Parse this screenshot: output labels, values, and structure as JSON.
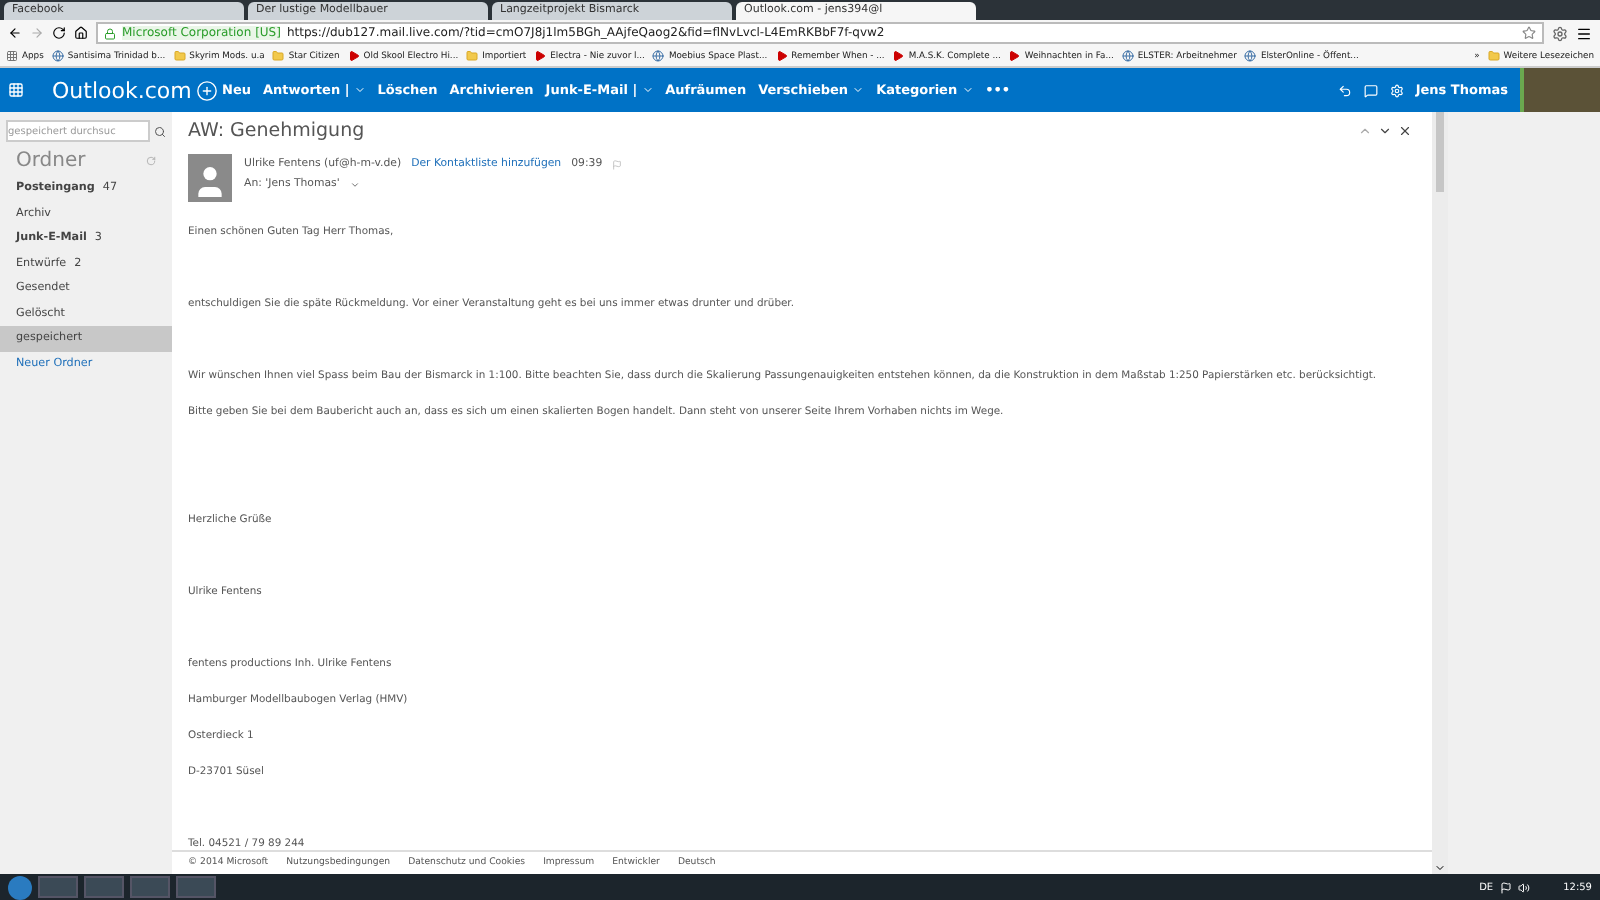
{
  "browser": {
    "tabs": [
      {
        "title": "Facebook",
        "selected": false
      },
      {
        "title": "Der lustige Modellbauer",
        "selected": false
      },
      {
        "title": "Langzeitprojekt Bismarck",
        "selected": false
      },
      {
        "title": "Outlook.com - jens394@l",
        "selected": true
      }
    ],
    "address": {
      "secure_label": "Microsoft Corporation [US]",
      "url": "https://dub127.mail.live.com/?tid=cmO7J8j1lm5BGh_AAjfeQaog2&fid=flNvLvcl-L4EmRKBbF7f-qvw2"
    },
    "bookmarks": [
      {
        "label": "Apps",
        "kind": "apps"
      },
      {
        "label": "Santisima Trinidad b...",
        "kind": "site"
      },
      {
        "label": "Skyrim Mods. u.a",
        "kind": "folder"
      },
      {
        "label": "Star Citizen",
        "kind": "folder"
      },
      {
        "label": "Old Skool Electro Hi...",
        "kind": "video"
      },
      {
        "label": "Importiert",
        "kind": "folder"
      },
      {
        "label": "Electra - Nie zuvor l...",
        "kind": "video"
      },
      {
        "label": "Moebius Space Plast...",
        "kind": "site"
      },
      {
        "label": "Remember When - ...",
        "kind": "video"
      },
      {
        "label": "M.A.S.K. Complete ...",
        "kind": "video"
      },
      {
        "label": "Weihnachten in Fa...",
        "kind": "video"
      },
      {
        "label": "ELSTER: Arbeitnehmer",
        "kind": "site"
      },
      {
        "label": "ElsterOnline - Öffent...",
        "kind": "site"
      }
    ],
    "overflow": "»",
    "more_bookmarks": "Weitere Lesezeichen"
  },
  "outlook": {
    "brand": "Outlook.com",
    "commands": [
      {
        "label": "Neu",
        "kind": "new"
      },
      {
        "label": "Antworten",
        "kind": "split",
        "separator": "|"
      },
      {
        "label": "Löschen",
        "kind": "plain"
      },
      {
        "label": "Archivieren",
        "kind": "plain"
      },
      {
        "label": "Junk-E-Mail",
        "kind": "split",
        "separator": "|"
      },
      {
        "label": "Aufräumen",
        "kind": "plain"
      },
      {
        "label": "Verschieben",
        "kind": "dropdown"
      },
      {
        "label": "Kategorien",
        "kind": "dropdown"
      },
      {
        "label": "•••",
        "kind": "plain"
      }
    ],
    "user": "Jens Thomas"
  },
  "sidebar": {
    "search_placeholder": "gespeichert durchsuc",
    "title": "Ordner",
    "folders": [
      {
        "name": "Posteingang",
        "count": "47",
        "bold": true,
        "selected": false
      },
      {
        "name": "Archiv",
        "bold": false,
        "selected": false
      },
      {
        "name": "Junk-E-Mail",
        "count": "3",
        "bold": true,
        "selected": false
      },
      {
        "name": "Entwürfe",
        "count": "2",
        "bold": false,
        "selected": false
      },
      {
        "name": "Gesendet",
        "bold": false,
        "selected": false
      },
      {
        "name": "Gelöscht",
        "bold": false,
        "selected": false
      },
      {
        "name": "gespeichert",
        "bold": false,
        "selected": true
      }
    ],
    "new_folder": "Neuer Ordner"
  },
  "message": {
    "subject": "AW: Genehmigung",
    "sender": "Ulrike Fentens (uf@h-m-v.de)",
    "add_contact": "Der Kontaktliste hinzufügen",
    "time": "09:39",
    "to": "An: 'Jens Thomas'",
    "body": [
      {
        "kind": "text",
        "text": "Einen schönen Guten Tag Herr Thomas,"
      },
      {
        "kind": "blank"
      },
      {
        "kind": "text",
        "text": "entschuldigen Sie die späte Rückmeldung. Vor einer Veranstaltung geht es bei uns immer etwas drunter und drüber."
      },
      {
        "kind": "blank"
      },
      {
        "kind": "text",
        "text": "Wir wünschen Ihnen viel Spass beim Bau der Bismarck in 1:100. Bitte beachten Sie, dass durch die Skalierung Passungenauigkeiten entstehen können, da die Konstruktion in dem Maßstab 1:250 Papierstärken etc. berücksichtigt."
      },
      {
        "kind": "text",
        "text": "Bitte geben Sie bei dem Baubericht auch an, dass es sich um einen skalierten Bogen handelt. Dann steht von unserer Seite Ihrem Vorhaben nichts im Wege."
      },
      {
        "kind": "blank"
      },
      {
        "kind": "blank"
      },
      {
        "kind": "text",
        "text": "Herzliche Grüße"
      },
      {
        "kind": "blank"
      },
      {
        "kind": "text",
        "text": "Ulrike Fentens"
      },
      {
        "kind": "blank"
      },
      {
        "kind": "text",
        "text": "fentens productions Inh. Ulrike Fentens"
      },
      {
        "kind": "text",
        "text": "Hamburger Modellbaubogen Verlag (HMV)"
      },
      {
        "kind": "text",
        "text": "Osterdieck 1"
      },
      {
        "kind": "text",
        "text": "D-23701 Süsel"
      },
      {
        "kind": "blank"
      },
      {
        "kind": "text",
        "text": "Tel. 04521 / 79 89 244"
      }
    ]
  },
  "footer": [
    "© 2014 Microsoft",
    "Nutzungsbedingungen",
    "Datenschutz und Cookies",
    "Impressum",
    "Entwickler",
    "Deutsch"
  ],
  "taskbar": {
    "language": "DE",
    "time": "12:59"
  }
}
